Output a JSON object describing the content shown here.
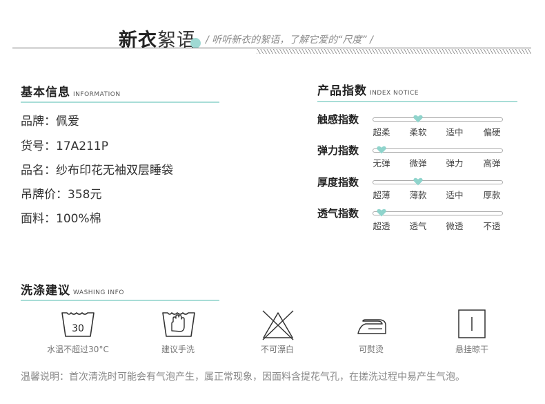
{
  "banner": {
    "title_bold": "新衣",
    "title_light": "絮语",
    "subtitle": "/ 听听新衣的絮语，了解它爱的“尺度” /"
  },
  "basic_info": {
    "title": "基本信息",
    "title_en": "INFORMATION",
    "rows": [
      "品牌：佩爱",
      "货号：17A211P",
      "品名：纱布印花无袖双层睡袋",
      "吊牌价：358元",
      "面料：100%棉"
    ]
  },
  "index_notice": {
    "title": "产品指数",
    "title_en": "INDEX NOTICE",
    "accent_color": "#8fd4cc",
    "indices": [
      {
        "label": "触感指数",
        "options": [
          "超柔",
          "柔软",
          "适中",
          "偏硬"
        ],
        "selected": 1
      },
      {
        "label": "弹力指数",
        "options": [
          "无弹",
          "微弹",
          "弹力",
          "高弹"
        ],
        "selected": 0
      },
      {
        "label": "厚度指数",
        "options": [
          "超薄",
          "薄款",
          "适中",
          "厚款"
        ],
        "selected": 1
      },
      {
        "label": "透气指数",
        "options": [
          "超透",
          "透气",
          "微透",
          "不透"
        ],
        "selected": 0
      }
    ]
  },
  "washing": {
    "title": "洗涤建议",
    "title_en": "WASHING INFO",
    "items": [
      {
        "icon": "wash-30-icon",
        "icon_text": "30",
        "label": "水温不超过30°C"
      },
      {
        "icon": "hand-wash-icon",
        "label": "建议手洗"
      },
      {
        "icon": "no-bleach-icon",
        "label": "不可漂白"
      },
      {
        "icon": "iron-icon",
        "label": "可熨烫"
      },
      {
        "icon": "hang-dry-icon",
        "label": "悬挂晾干"
      }
    ],
    "note": "温馨说明：首次清洗时可能会有气泡产生，属正常现象，因面料含提花气孔，在搓洗过程中易产生气泡。"
  }
}
